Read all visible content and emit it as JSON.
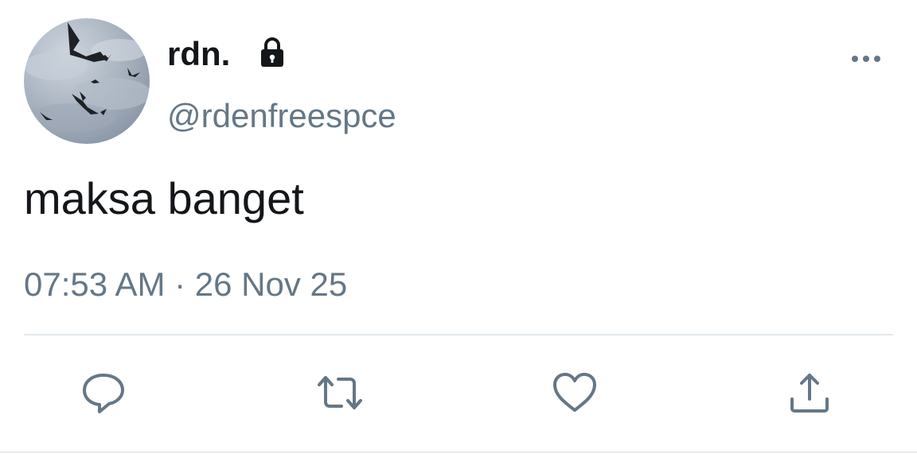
{
  "author": {
    "display_name": "rdn.",
    "handle": "@rdenfreespce",
    "protected_icon": "lock-icon",
    "avatar": "avatar-birds-cloudy-sky"
  },
  "tweet": {
    "text": "maksa banget",
    "timestamp": "07:53 AM · 26 Nov 25"
  },
  "menu_icon": "more-icon",
  "actions": [
    {
      "name": "reply",
      "icon": "reply-icon"
    },
    {
      "name": "retweet",
      "icon": "retweet-icon"
    },
    {
      "name": "like",
      "icon": "heart-icon"
    },
    {
      "name": "share",
      "icon": "share-icon"
    }
  ],
  "colors": {
    "primary_text": "#14171a",
    "secondary_text": "#657786",
    "divider": "#e1e8ed"
  }
}
